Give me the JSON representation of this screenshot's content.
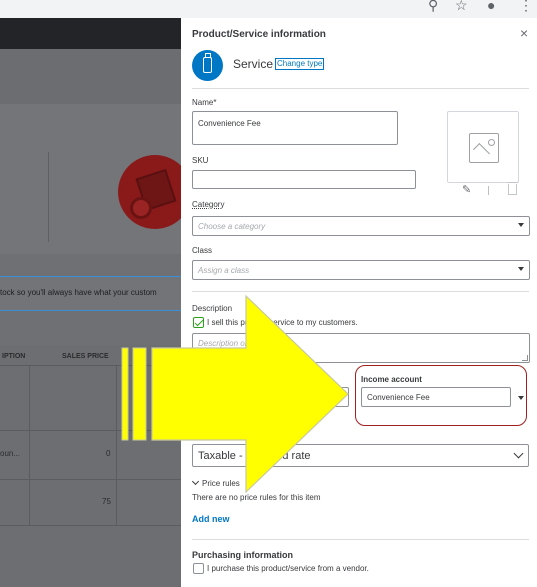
{
  "background": {
    "banner_text": "tock so you'll always have what your custom",
    "table": {
      "headers": [
        "IPTION",
        "SALES PRICE"
      ],
      "rows": [
        {
          "desc": "oun...",
          "price": "0"
        },
        {
          "desc": "",
          "price": "75"
        }
      ]
    }
  },
  "panel": {
    "title": "Product/Service information",
    "close_icon": "×",
    "type_label": "Service",
    "change_type": "Change type",
    "name": {
      "label": "Name*",
      "value": "Convenience Fee"
    },
    "sku": {
      "label": "SKU",
      "value": ""
    },
    "category": {
      "label": "Category",
      "placeholder": "Choose a category"
    },
    "class": {
      "label": "Class",
      "placeholder": "Assign a class"
    },
    "description": {
      "label": "Description",
      "sell_checkbox_label": "I sell this product/service to my customers.",
      "sell_checked": true,
      "placeholder": "Description on sales forms"
    },
    "sales_price": {
      "value": "0"
    },
    "income_account": {
      "label": "Income account",
      "value": "Convenience Fee"
    },
    "tax": {
      "value": "Taxable - standard rate"
    },
    "price_rules": {
      "label": "Price rules",
      "empty_text": "There are no price rules for this item",
      "add_new": "Add new"
    },
    "purchasing": {
      "title": "Purchasing information",
      "checkbox_label": "I purchase this product/service from a vendor.",
      "checked": false
    }
  },
  "colors": {
    "brand_blue": "#0077c5",
    "check_green": "#2ca01c",
    "highlight_red": "#a02020",
    "arrow_yellow": "#ffff00"
  },
  "icons": [
    "zoom-icon",
    "star-icon",
    "account-icon",
    "menu-dots-icon",
    "close-icon",
    "service-bottle-icon",
    "image-placeholder-icon",
    "pencil-icon",
    "trash-icon",
    "caret-down-icon",
    "chevron-down-icon",
    "out-of-stock-icon"
  ]
}
